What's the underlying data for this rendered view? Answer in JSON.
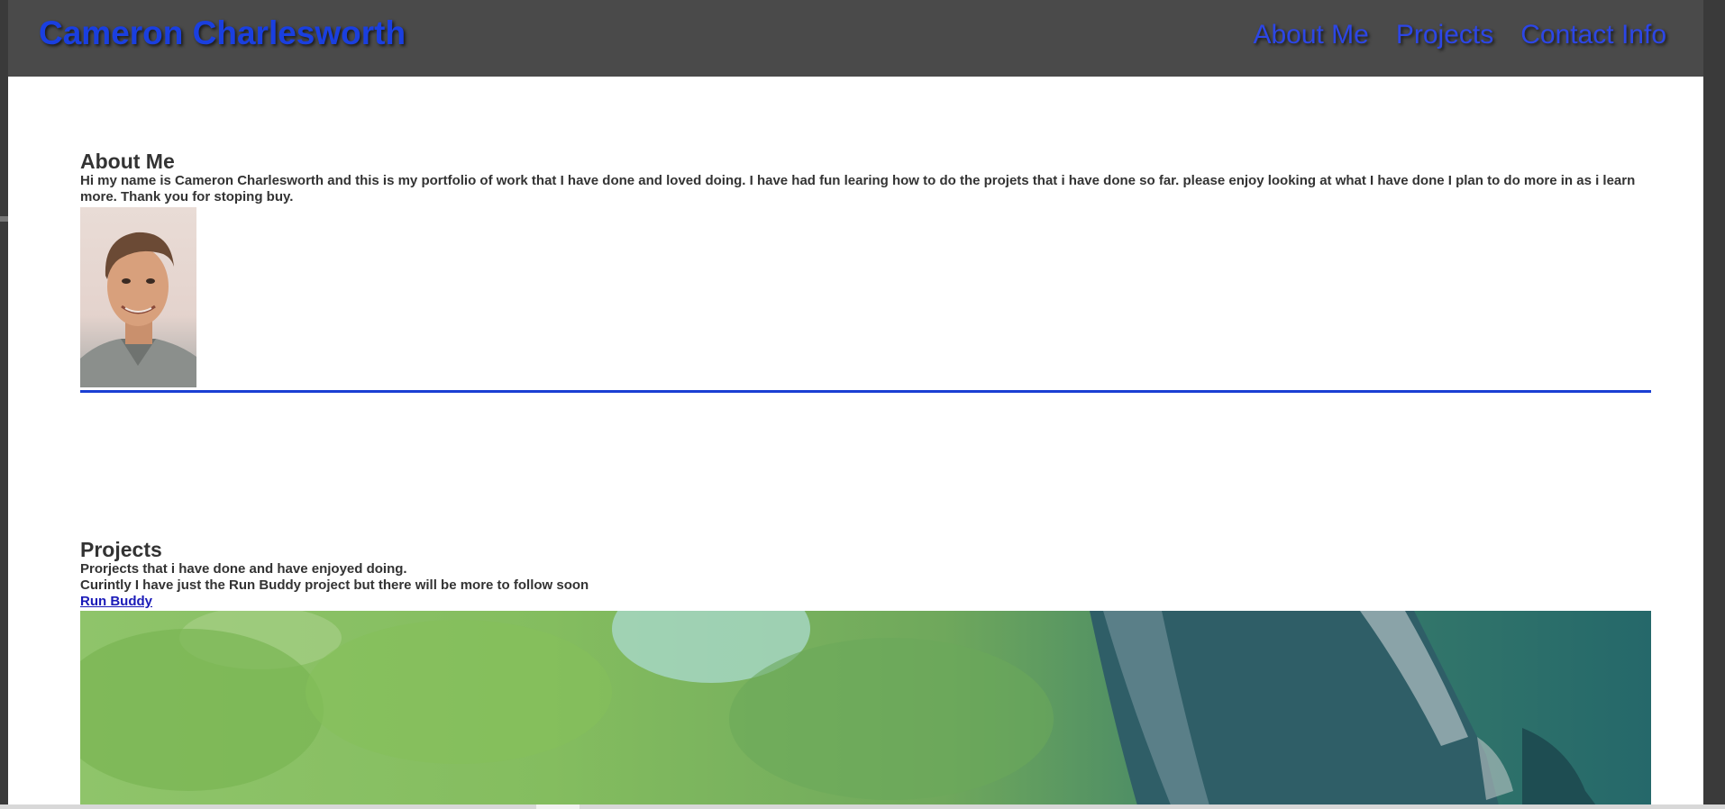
{
  "header": {
    "site_title": "Cameron Charlesworth",
    "nav": [
      {
        "label": "About Me"
      },
      {
        "label": "Projects"
      },
      {
        "label": "Contact Info"
      }
    ]
  },
  "about": {
    "heading": "About Me",
    "body": "Hi my name is Cameron Charlesworth and this is my portfolio of work that I have done and loved doing. I have had fun learing how to do the projets that i have done so far. please enjoy looking at what I have done I plan to do more in as i learn more. Thank you for stoping buy."
  },
  "projects": {
    "heading": "Projects",
    "line1": "Prorjects that i have done and have enjoyed doing.",
    "line2": "Curintly I have just the Run Buddy project but there will be more to follow soon",
    "link_label": "Run Buddy"
  },
  "colors": {
    "header_bg": "#4a4a4a",
    "accent": "#1a3fe0",
    "text": "#333333",
    "divider": "#1a3fd3"
  },
  "icons": [
    "portrait-photo",
    "run-buddy-photo"
  ]
}
